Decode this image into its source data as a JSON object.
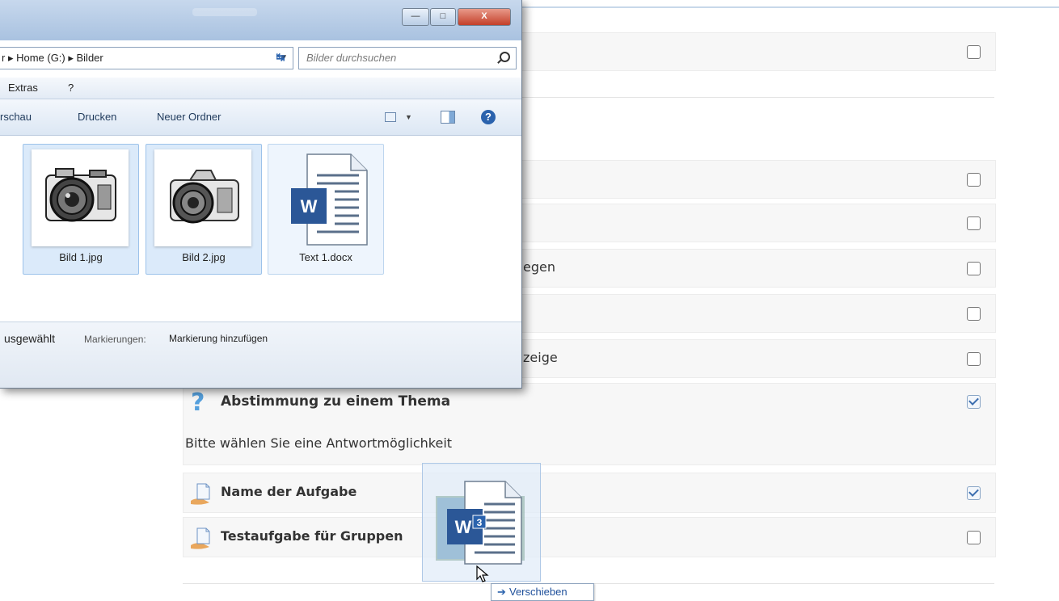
{
  "explorer": {
    "breadcrumb": "r ▸ Home (G:) ▸ Bilder",
    "search_placeholder": "Bilder durchsuchen",
    "menu": [
      "Extras",
      "?"
    ],
    "toolbar": [
      "rschau",
      "Drucken",
      "Neuer Ordner"
    ],
    "window_buttons": {
      "minimize": "—",
      "maximize": "□",
      "close": "X"
    },
    "files": [
      {
        "name": "Bild 1.jpg",
        "kind": "image"
      },
      {
        "name": "Bild 2.jpg",
        "kind": "image"
      },
      {
        "name": "Text 1.docx",
        "kind": "word"
      }
    ],
    "status": {
      "selected": "usgewählt",
      "tags_label": "Markierungen:",
      "tags_value": "Markierung hinzufügen"
    }
  },
  "course": {
    "partial_rows": [
      "egen",
      "zeige"
    ],
    "quiz_title": "Abstimmung zu einem Thema",
    "quiz_subtitle": "Bitte wählen Sie eine Antwortmöglichkeit",
    "assignments": [
      {
        "label": "Name der Aufgabe",
        "checked": true
      },
      {
        "label": "Testaufgabe für Gruppen",
        "checked": false
      }
    ]
  },
  "drag": {
    "badge": "3",
    "word_letter": "W",
    "tooltip": "Verschieben"
  },
  "colors": {
    "accent": "#2a62ad",
    "word_blue": "#2b5797",
    "quiz_icon": "#55a0dd"
  }
}
